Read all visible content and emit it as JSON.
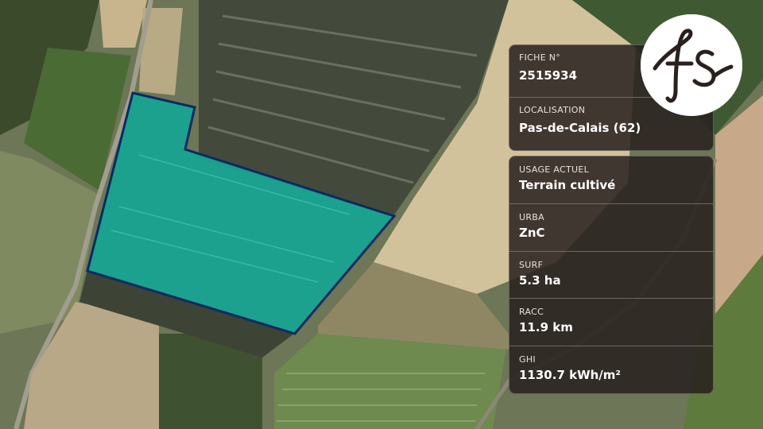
{
  "header_card": {
    "fiche": {
      "label": "FICHE N°",
      "value": "2515934"
    },
    "localisation": {
      "label": "LOCALISATION",
      "value": "Pas-de-Calais (62)"
    }
  },
  "details_card": {
    "usage": {
      "label": "USAGE ACTUEL",
      "value": "Terrain cultivé"
    },
    "urba": {
      "label": "URBA",
      "value": "ZnC"
    },
    "surf": {
      "label": "SURF",
      "value": "5.3 ha"
    },
    "racc": {
      "label": "RACC",
      "value": "11.9 km"
    },
    "ghi": {
      "label": "GHI",
      "value": "1130.7 kWh/m²"
    }
  },
  "logo": {
    "text": "fs"
  },
  "colors": {
    "parcel_fill": "#16a592",
    "parcel_stroke": "#0b2a63",
    "panel_bg": "#2a201e"
  }
}
